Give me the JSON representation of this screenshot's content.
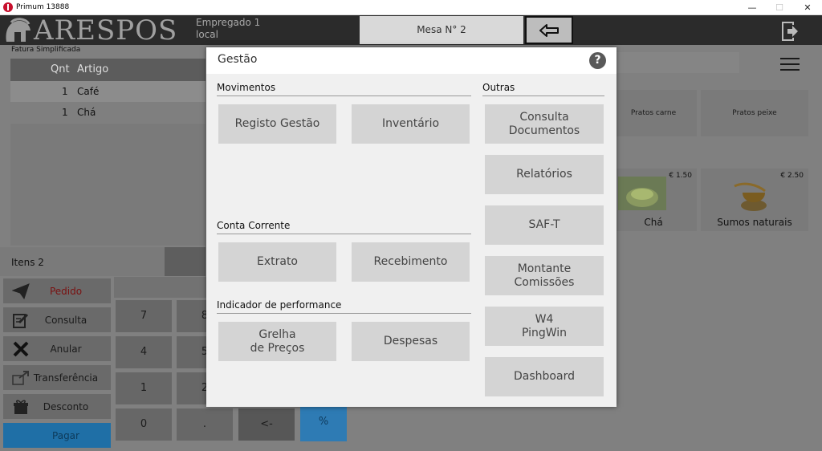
{
  "window": {
    "title": "Primum 13888",
    "minimize": "—",
    "maximize": "☐",
    "close": "✕"
  },
  "header": {
    "logo_text": "ARESPOS",
    "employee": "Empregado 1",
    "location": "local",
    "table_label": "Mesa N° 2"
  },
  "ticket": {
    "doc_type": "Fatura Simplificada",
    "columns": {
      "qty": "Qnt",
      "item": "Artigo"
    },
    "rows": [
      {
        "qty": "1",
        "item": "Café"
      },
      {
        "qty": "1",
        "item": "Chá"
      }
    ],
    "items_count": "Itens 2"
  },
  "actions": [
    {
      "label": "Pedido",
      "icon": "paper-plane-icon"
    },
    {
      "label": "Consulta",
      "icon": "edit-icon"
    },
    {
      "label": "Anular",
      "icon": "x-icon"
    },
    {
      "label": "Transferência",
      "icon": "transfer-icon"
    },
    {
      "label": "Desconto",
      "icon": "gift-icon"
    },
    {
      "label": "Pagar",
      "icon": "pay-icon"
    }
  ],
  "keypad": {
    "k7": "7",
    "k8": "8",
    "k4": "4",
    "k5": "5",
    "k1": "1",
    "k2": "2",
    "k0": "0",
    "kdot": ".",
    "kback": "<-",
    "kpct": "%"
  },
  "categories": [
    {
      "label": "Pratos carne"
    },
    {
      "label": "Pratos peixe"
    }
  ],
  "products": [
    {
      "name": "Chá",
      "price": "€ 1.50"
    },
    {
      "name": "Sumos naturais",
      "price": "€ 2.50"
    }
  ],
  "modal": {
    "title": "Gestão",
    "help": "?",
    "sections": {
      "movimentos": "Movimentos",
      "conta_corrente": "Conta Corrente",
      "indicador": "Indicador de performance",
      "outras": "Outras"
    },
    "buttons": {
      "registo_gestao": "Registo Gestão",
      "inventario": "Inventário",
      "extrato": "Extrato",
      "recebimento": "Recebimento",
      "grelha_precos": "Grelha\nde Preços",
      "despesas": "Despesas",
      "consulta_documentos": "Consulta\nDocumentos",
      "relatorios": "Relatórios",
      "saft": "SAF-T",
      "montante_comissoes": "Montante\nComissões",
      "w4_pingwin": "W4\nPingWin",
      "dashboard": "Dashboard"
    }
  },
  "colors": {
    "accent_red": "#c8102e",
    "pay_blue": "#1f6fa6",
    "header_dark": "#2b2b2b"
  }
}
